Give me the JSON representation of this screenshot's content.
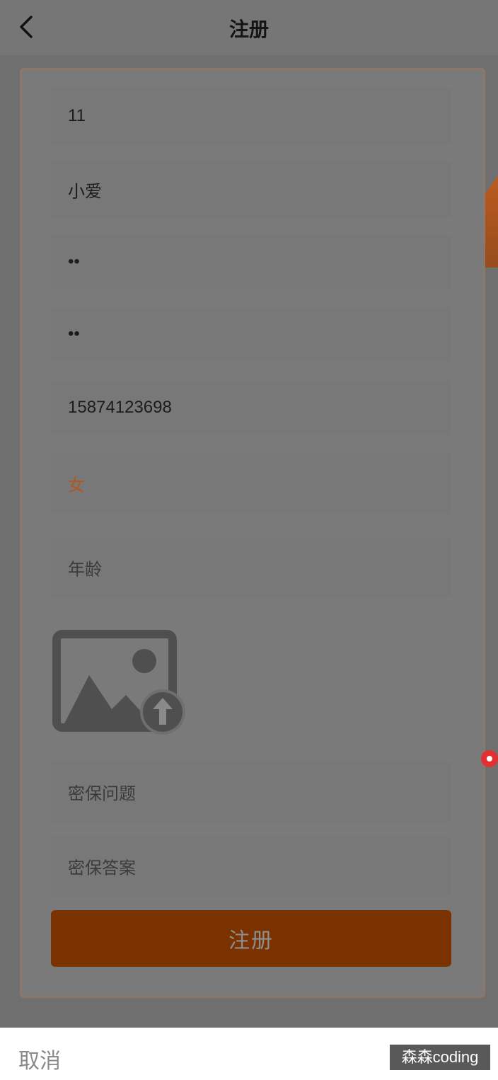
{
  "header": {
    "title": "注册"
  },
  "form": {
    "username_value": "11",
    "nickname_value": "小爱",
    "password_value": "••",
    "confirm_password_value": "••",
    "phone_value": "15874123698",
    "gender_value": "女",
    "age_placeholder": "年龄",
    "security_question_placeholder": "密保问题",
    "security_answer_placeholder": "密保答案",
    "submit_label": "注册"
  },
  "bottom": {
    "cancel_label": "取消",
    "watermark": "森森coding"
  },
  "colors": {
    "accent": "#c35a16",
    "button": "#7a3200",
    "overlay": "#6f6f6f"
  },
  "icons": {
    "back": "chevron-left-icon",
    "upload": "image-upload-icon"
  }
}
